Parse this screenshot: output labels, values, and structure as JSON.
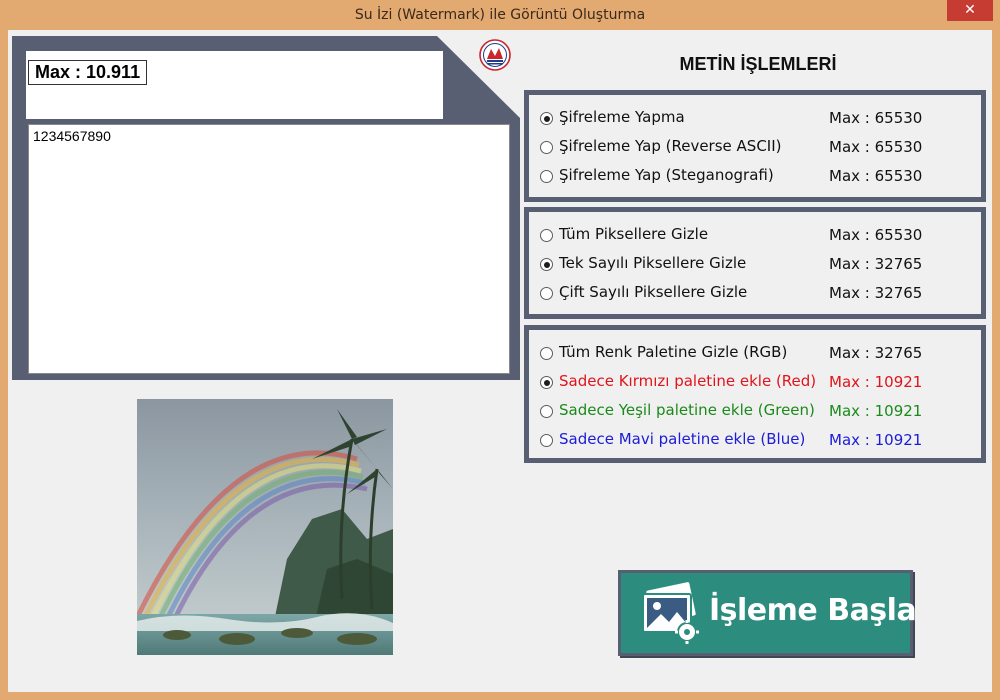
{
  "window": {
    "title": "Su İzi (Watermark) ile Görüntü Oluşturma",
    "close_label": "✕"
  },
  "text_panel": {
    "max_label": "Max : 10.911",
    "input_value": "1234567890"
  },
  "section_title": "METİN İŞLEMLERİ",
  "group1": [
    {
      "label": "Şifreleme Yapma",
      "max": "Max : 65530",
      "checked": true
    },
    {
      "label": "Şifreleme Yap (Reverse ASCII)",
      "max": "Max : 65530",
      "checked": false
    },
    {
      "label": "Şifreleme Yap (Steganografi)",
      "max": "Max : 65530",
      "checked": false
    }
  ],
  "group2": [
    {
      "label": "Tüm Piksellere Gizle",
      "max": "Max : 65530",
      "checked": false
    },
    {
      "label": "Tek Sayılı Piksellere Gizle",
      "max": "Max : 32765",
      "checked": true
    },
    {
      "label": "Çift Sayılı Piksellere Gizle",
      "max": "Max : 32765",
      "checked": false
    }
  ],
  "group3": [
    {
      "label": "Tüm Renk Paletine Gizle (RGB)",
      "max": "Max : 32765",
      "checked": false,
      "color": "#111111"
    },
    {
      "label": "Sadece Kırmızı paletine ekle (Red)",
      "max": "Max : 10921",
      "checked": true,
      "color": "#e0141c"
    },
    {
      "label": "Sadece Yeşil paletine ekle (Green)",
      "max": "Max : 10921",
      "checked": false,
      "color": "#1b8a1b"
    },
    {
      "label": "Sadece Mavi paletine ekle (Blue)",
      "max": "Max : 10921",
      "checked": false,
      "color": "#1c1cd8"
    }
  ],
  "start_button": {
    "label": "İşleme Başla",
    "icon": "image-gear-icon"
  },
  "colors": {
    "panel": "#585f72",
    "button": "#2c8c7d",
    "titlebar": "#e2a971",
    "close": "#c73c32"
  }
}
